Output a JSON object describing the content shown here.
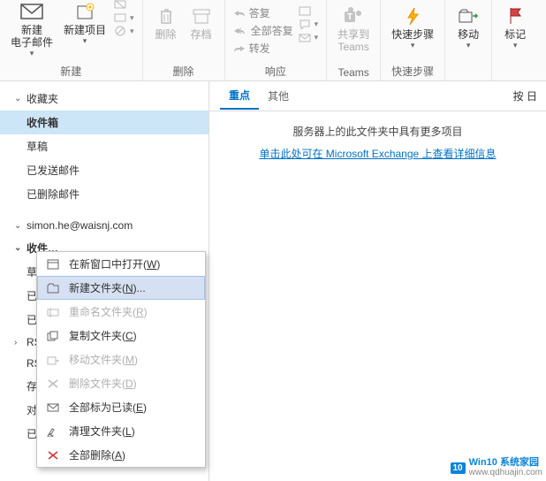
{
  "ribbon": {
    "new": {
      "group_label": "新建",
      "new_mail": "新建\n电子邮件",
      "new_item": "新建项目"
    },
    "delete": {
      "group_label": "删除",
      "delete": "删除",
      "archive": "存档"
    },
    "respond": {
      "group_label": "响应",
      "reply": "答复",
      "reply_all": "全部答复",
      "forward": "转发"
    },
    "teams": {
      "group_label": "Teams",
      "share": "共享到\nTeams"
    },
    "quick": {
      "group_label": "快速步骤",
      "label": "快速步骤"
    },
    "move": {
      "group_label": "",
      "label": "移动"
    },
    "tag": {
      "group_label": "",
      "label": "标记"
    }
  },
  "sidebar": {
    "favorites": "收藏夹",
    "fav_items": [
      "收件箱",
      "草稿",
      "已发送邮件",
      "已删除邮件"
    ],
    "account": "simon.he@waisnj.com",
    "acct_items": [
      "收件…",
      "草…",
      "已…",
      "已…",
      "RS…",
      "RS…",
      "存…",
      "对…",
      "已…"
    ],
    "acct_expandable_idx": 4
  },
  "tabs": {
    "focused": "重点",
    "other": "其他",
    "right": "按 日"
  },
  "messages": {
    "server_more": "服务器上的此文件夹中具有更多项目",
    "view_details": "单击此处可在 Microsoft Exchange 上查看详细信息"
  },
  "context_menu": {
    "items": [
      {
        "label": "在新窗口中打开(W)",
        "disabled": false,
        "icon": "window"
      },
      {
        "label": "新建文件夹(N)...",
        "disabled": false,
        "icon": "folder-new",
        "hover": true
      },
      {
        "label": "重命名文件夹(R)",
        "disabled": true,
        "icon": "rename"
      },
      {
        "label": "复制文件夹(C)",
        "disabled": false,
        "icon": "copy"
      },
      {
        "label": "移动文件夹(M)",
        "disabled": true,
        "icon": "move"
      },
      {
        "label": "删除文件夹(D)",
        "disabled": true,
        "icon": "delete"
      },
      {
        "label": "全部标为已读(E)",
        "disabled": false,
        "icon": "mark-read"
      },
      {
        "label": "清理文件夹(L)",
        "disabled": false,
        "icon": "cleanup"
      },
      {
        "label": "全部删除(A)",
        "disabled": false,
        "icon": "delete-all"
      }
    ]
  },
  "watermark": {
    "badge": "10",
    "title": "Win10 系统家园",
    "url": "www.qdhuajin.com"
  }
}
